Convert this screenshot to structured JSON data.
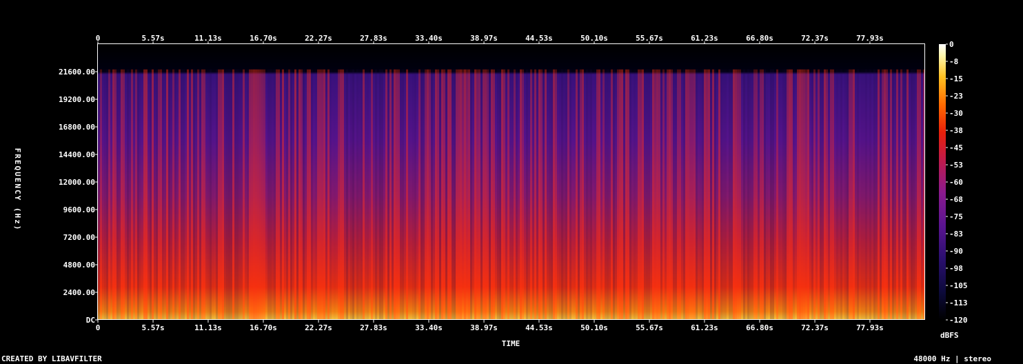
{
  "chart_data": {
    "type": "heatmap",
    "xlabel": "TIME",
    "ylabel": "FREQUENCY (Hz)",
    "x_ticks": [
      "0",
      "5.57s",
      "11.13s",
      "16.70s",
      "22.27s",
      "27.83s",
      "33.40s",
      "38.97s",
      "44.53s",
      "50.10s",
      "55.67s",
      "61.23s",
      "66.80s",
      "72.37s",
      "77.93s"
    ],
    "x_tick_values": [
      0,
      5.57,
      11.13,
      16.7,
      22.27,
      27.83,
      33.4,
      38.97,
      44.53,
      50.1,
      55.67,
      61.23,
      66.8,
      72.37,
      77.93
    ],
    "xlim": [
      0,
      83.5
    ],
    "y_ticks": [
      "DC",
      "2400.00",
      "4800.00",
      "7200.00",
      "9600.00",
      "12000.00",
      "14400.00",
      "16800.00",
      "19200.00",
      "21600.00"
    ],
    "y_tick_values": [
      0,
      2400,
      4800,
      7200,
      9600,
      12000,
      14400,
      16800,
      19200,
      21600
    ],
    "ylim": [
      0,
      24000
    ],
    "colorbar": {
      "ticks": [
        "0",
        "-8",
        "-15",
        "-23",
        "-30",
        "-38",
        "-45",
        "-53",
        "-60",
        "-68",
        "-75",
        "-83",
        "-90",
        "-98",
        "-105",
        "-113",
        "-120"
      ],
      "range": [
        -120,
        0
      ],
      "unit": "dBFS"
    },
    "content_cutoff_hz": 21800,
    "colors": {
      "palette": [
        "#000000",
        "#0c0a3a",
        "#2a0f6e",
        "#5a1490",
        "#8a1a8e",
        "#c01a4a",
        "#e8200a",
        "#ff6a00",
        "#ffc020",
        "#fff8b0",
        "#ffffff"
      ]
    }
  },
  "footer": {
    "left": "CREATED BY LIBAVFILTER",
    "right": "48000 Hz | stereo"
  }
}
